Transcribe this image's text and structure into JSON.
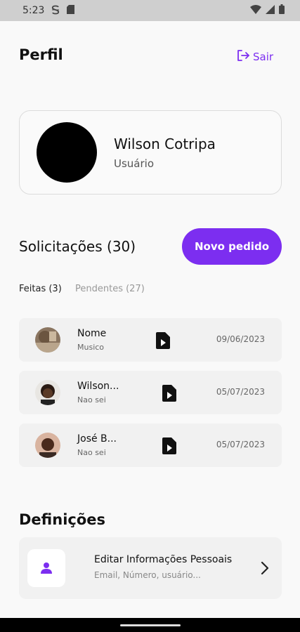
{
  "status_bar": {
    "time": "5:23",
    "left_icons": [
      "s-icon",
      "sd-card-icon"
    ],
    "right_icons": [
      "wifi-icon",
      "signal-icon",
      "battery-icon"
    ]
  },
  "header": {
    "title": "Perfil",
    "logout_label": "Sair"
  },
  "profile": {
    "name": "Wilson Cotripa",
    "role": "Usuário"
  },
  "requests": {
    "title": "Solicitações (30)",
    "new_button": "Novo pedido",
    "tabs": [
      {
        "label": "Feitas (3)",
        "active": true
      },
      {
        "label": "Pendentes (27)",
        "active": false
      }
    ],
    "items": [
      {
        "name": "Nome",
        "subtitle": "Musico",
        "date": "09/06/2023"
      },
      {
        "name": "Wilson...",
        "subtitle": "Nao sei",
        "date": "05/07/2023"
      },
      {
        "name": "José B...",
        "subtitle": "Nao sei",
        "date": "05/07/2023"
      }
    ]
  },
  "settings": {
    "title": "Definições",
    "items": [
      {
        "label": "Editar Informações Pessoais",
        "subtitle": "Email, Número, usuário..."
      }
    ]
  },
  "colors": {
    "accent": "#7c2ef0",
    "background": "#f9f9f9",
    "card": "#f1f1f1"
  }
}
